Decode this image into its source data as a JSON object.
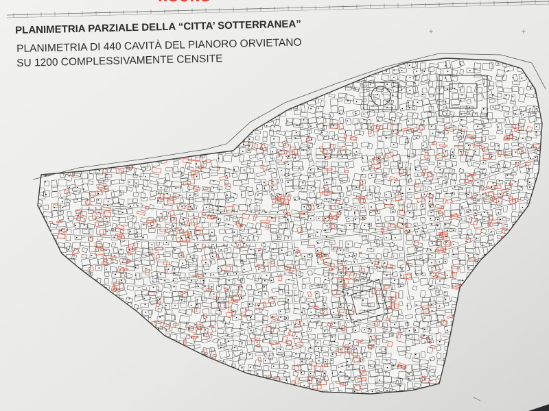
{
  "board": {
    "banner": "ROUND",
    "title": "PLANIMETRIA PARZIALE DELLA “CITTA’ SOTTERRANEA”",
    "subtitle_line1": "PLANIMETRIA DI 440 CAVITÀ DEL PIANORO ORVIETANO",
    "subtitle_line2": "SU 1200 COMPLESSIVAMENTE CENSITE"
  },
  "colors": {
    "board_bg": "#e9e9e7",
    "outline": "#3a3a3a",
    "cavity": "#d8553d",
    "banner": "#e8432e",
    "surround": "#2a2a2c"
  }
}
